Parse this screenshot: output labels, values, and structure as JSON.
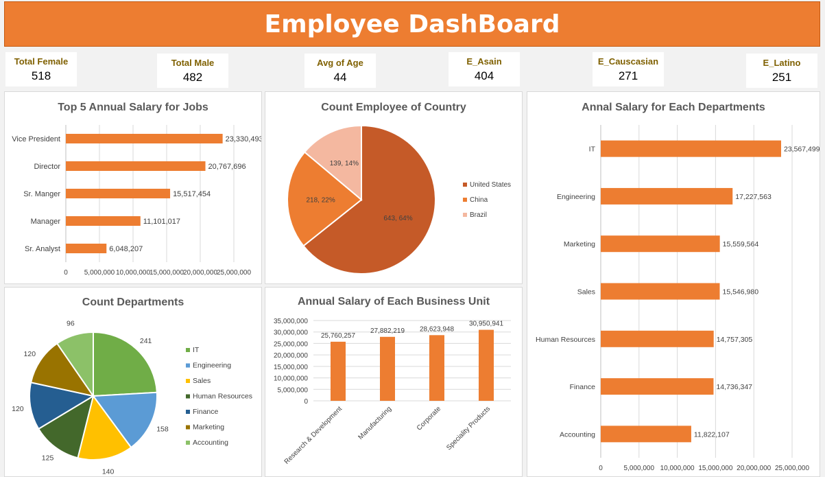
{
  "header": {
    "title": "Employee DashBoard"
  },
  "kpis": [
    {
      "label": "Total Female",
      "value": "518"
    },
    {
      "label": "Total Male",
      "value": "482"
    },
    {
      "label": "Avg of Age",
      "value": "44"
    },
    {
      "label": "E_Asain",
      "value": "404"
    },
    {
      "label": "E_Causcasian",
      "value": "271"
    },
    {
      "label": "E_Latino",
      "value": "251"
    }
  ],
  "colors": {
    "accent": "#ed7d31",
    "kpi_label": "#7f6000"
  },
  "chart_data": [
    {
      "id": "jobs",
      "type": "bar",
      "orientation": "horizontal",
      "title": "Top 5 Annual Salary  for Jobs",
      "categories": [
        "Vice President",
        "Director",
        "Sr. Manger",
        "Manager",
        "Sr. Analyst"
      ],
      "values": [
        23330493,
        20767696,
        15517454,
        11101017,
        6048207
      ],
      "value_labels": [
        "23,330,493",
        "20,767,696",
        "15,517,454",
        "11,101,017",
        "6,048,207"
      ],
      "xlim": [
        0,
        25000000
      ],
      "xticks": [
        "0",
        "5,000,000",
        "10,000,000",
        "15,000,000",
        "20,000,000",
        "25,000,000"
      ],
      "grid": true,
      "color": "#ed7d31"
    },
    {
      "id": "country",
      "type": "pie",
      "title": "Count Employee of Country",
      "categories": [
        "United States",
        "China",
        "Brazil"
      ],
      "values": [
        643,
        218,
        139
      ],
      "slice_labels": [
        "643, 64%",
        "218, 22%",
        "139, 14%"
      ],
      "colors": [
        "#c55a28",
        "#ed7d31",
        "#f4b8a0"
      ],
      "legend": "right"
    },
    {
      "id": "departments_salary",
      "type": "bar",
      "orientation": "horizontal",
      "title": "Annal Salary for Each Departments",
      "categories": [
        "IT",
        "Engineering",
        "Marketing",
        "Sales",
        "Human Resources",
        "Finance",
        "Accounting"
      ],
      "values": [
        23567499,
        17227563,
        15559564,
        15546980,
        14757305,
        14736347,
        11822107
      ],
      "value_labels": [
        "23,567,499",
        "17,227,563",
        "15,559,564",
        "15,546,980",
        "14,757,305",
        "14,736,347",
        "11,822,107"
      ],
      "xlim": [
        0,
        25000000
      ],
      "xticks": [
        "0",
        "5,000,000",
        "10,000,000",
        "15,000,000",
        "20,000,000",
        "25,000,000"
      ],
      "grid": true,
      "color": "#ed7d31"
    },
    {
      "id": "dept_count",
      "type": "pie",
      "title": "Count Departments",
      "categories": [
        "IT",
        "Engineering",
        "Sales",
        "Human Resources",
        "Finance",
        "Marketing",
        "Accounting"
      ],
      "values": [
        241,
        158,
        140,
        125,
        120,
        120,
        96
      ],
      "slice_labels": [
        "241",
        "158",
        "140",
        "125",
        "120",
        "120",
        "96"
      ],
      "colors": [
        "#70ad47",
        "#5b9bd5",
        "#ffc000",
        "#43682b",
        "#255e91",
        "#997300",
        "#8cc168"
      ],
      "legend": "right"
    },
    {
      "id": "business_unit",
      "type": "bar",
      "orientation": "vertical",
      "title": "Annual Salary of Each Business Unit",
      "categories": [
        "Research & Development",
        "Manufacturing",
        "Corporate",
        "Speciality Products"
      ],
      "values": [
        25760257,
        27882219,
        28623948,
        30950941
      ],
      "value_labels": [
        "25,760,257",
        "27,882,219",
        "28,623,948",
        "30,950,941"
      ],
      "ylim": [
        0,
        35000000
      ],
      "yticks": [
        "0",
        "5,000,000",
        "10,000,000",
        "15,000,000",
        "20,000,000",
        "25,000,000",
        "30,000,000",
        "35,000,000"
      ],
      "grid": true,
      "color": "#ed7d31"
    }
  ]
}
